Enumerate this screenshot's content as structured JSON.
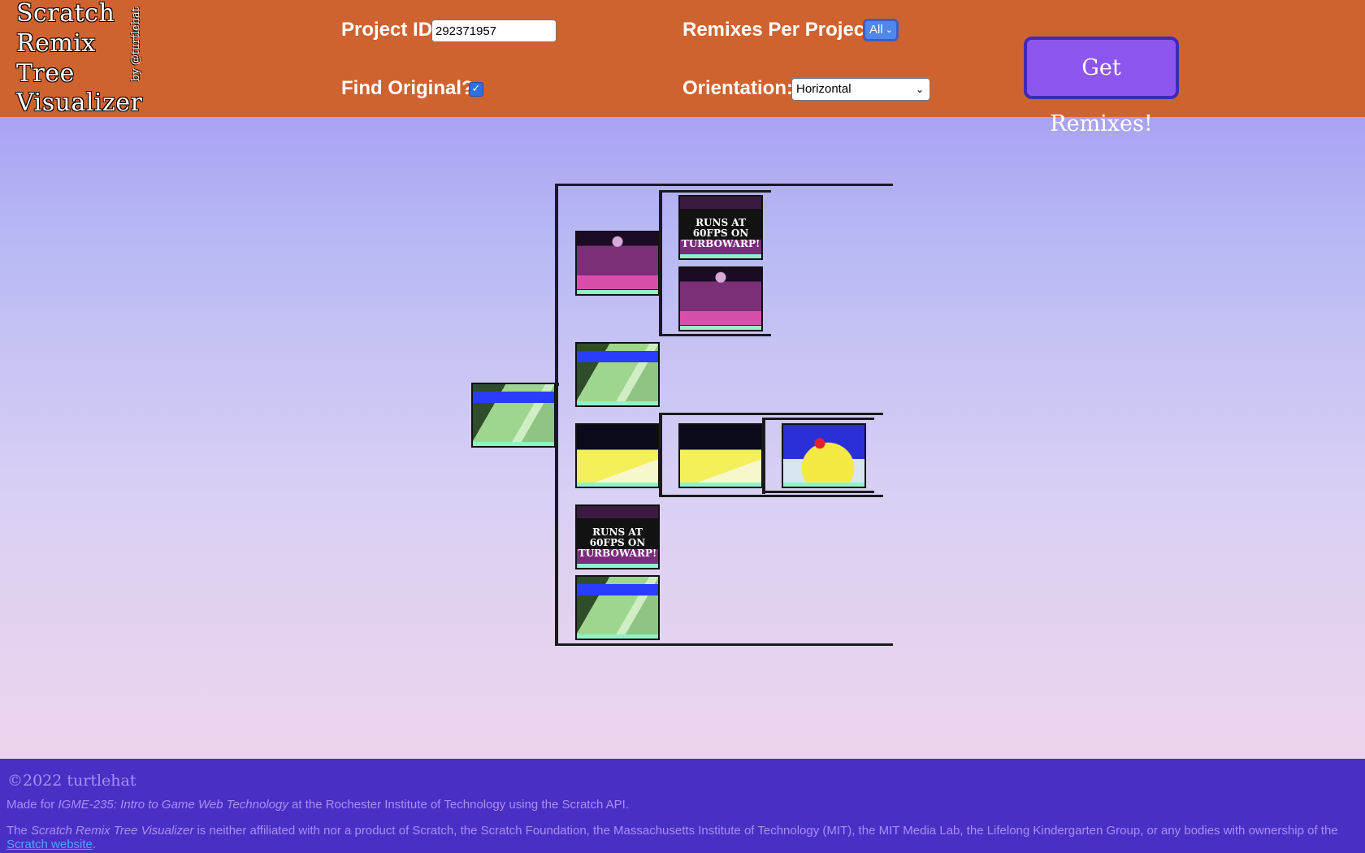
{
  "logo": {
    "line1": "Scratch",
    "line2": "Remix",
    "line3": "Tree",
    "line4": "Visualizer",
    "byline": "by @turtlehat"
  },
  "form": {
    "project_id_label": "Project ID:",
    "project_id_value": "292371957",
    "find_original_label": "Find Original?",
    "find_original_checked": true,
    "remixes_label": "Remixes Per Project:",
    "remixes_value": "All",
    "orientation_label": "Orientation:",
    "orientation_value": "Horizontal",
    "submit_label": "Get Remixes!"
  },
  "tree": {
    "root": {
      "image": "tennis-court-thumbnail"
    },
    "children": [
      {
        "image": "stage-thumbnail",
        "children": [
          {
            "image": "stage-thumbnail",
            "caption": "RUNS AT 60FPS ON TURBOWARP!"
          },
          {
            "image": "stage-thumbnail"
          }
        ]
      },
      {
        "image": "tennis-court-thumbnail"
      },
      {
        "image": "yellow-court-thumbnail",
        "children": [
          {
            "image": "yellow-court-thumbnail",
            "children": [
              {
                "image": "yellow-duck-thumbnail"
              }
            ]
          }
        ]
      },
      {
        "image": "tennis-court-thumbnail",
        "caption": "RUNS AT 60FPS ON TURBOWARP!"
      },
      {
        "image": "tennis-court-thumbnail"
      }
    ]
  },
  "footer": {
    "copyright": "©2022 turtlehat",
    "made_for_prefix": "Made for ",
    "made_for_course": "IGME-235: Intro to Game Web Technology",
    "made_for_suffix": " at the Rochester Institute of Technology using the Scratch API.",
    "disclaimer_prefix": "The ",
    "disclaimer_name": "Scratch Remix Tree Visualizer",
    "disclaimer_body": " is neither affiliated with nor a product of Scratch, the Scratch Foundation, the Massachusetts Institute of Technology (MIT), the MIT Media Lab, the Lifelong Kindergarten Group, or any bodies with ownership of the ",
    "disclaimer_link": "Scratch website",
    "disclaimer_end": "."
  },
  "colors": {
    "header": "#cf6330",
    "footer": "#4a2fc4",
    "button": "#8e56f0"
  }
}
